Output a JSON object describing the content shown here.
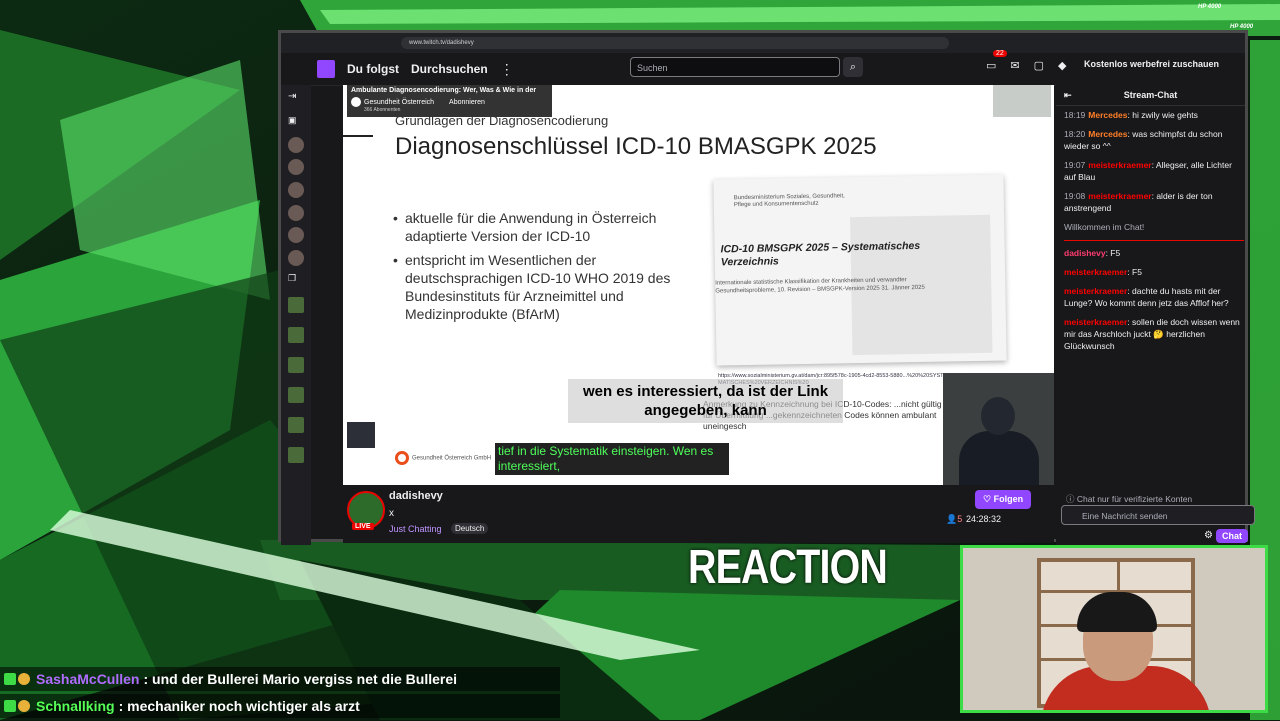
{
  "overlay": {
    "hp_top": "HP 4000",
    "hp_right": "HP 4000",
    "reaction_label": "REACTION",
    "chat_messages": [
      {
        "user": "SashaMcCullen",
        "text": ": und der Bullerei Mario vergiss net die Bullerei",
        "user_color": "#b06cff"
      },
      {
        "user": "Schnallking",
        "text": ": mechaniker noch wichtiger als arzt",
        "user_color": "#55ff55"
      }
    ]
  },
  "browser": {
    "url": "www.twitch.tv/dadishevy"
  },
  "twitch": {
    "nav": {
      "following": "Du folgst",
      "browse": "Durchsuchen",
      "more": "⋮"
    },
    "search": {
      "placeholder": "Suchen"
    },
    "notifications_count": "22",
    "adfree_label": "Kostenlos werbefrei zuschauen"
  },
  "video": {
    "yt_title": "Ambulante Diagnosencodierung: Wer, Was & Wie in der",
    "yt_channel": "Gesundheit Österreich",
    "yt_subs": "366 Abonnenten",
    "yt_subscribe": "Abonnieren",
    "slide_subtitle": "Grundlagen der Diagnosencodierung",
    "slide_title": "Diagnosenschlüssel ICD-10 BMASGPK 2025",
    "bullets": [
      "aktuelle für die Anwendung in Österreich adaptierte Version der ICD-10",
      "entspricht im Wesentlichen der deutschsprachigen ICD-10 WHO 2019 des Bundesinstituts für Arzneimittel und Medizinprodukte (BfArM)"
    ],
    "doc_department": "Bundesministerium Soziales, Gesundheit, Pflege und Konsumentenschutz",
    "doc_title": "ICD-10 BMSGPK 2025 – Systematisches Verzeichnis",
    "doc_subtitle": "Internationale statistische Klassifikation der Krankheiten und verwandter Gesundheitsprobleme, 10. Revision – BMSGPK-Version 2025 31. Jänner 2025",
    "link": "https://www.sozialministerium.gv.at/dam/jcr:895f578c-1905-4cd2-8553-5880...%20%20SYSTEMATISCHES%20VERZEICHNIS%20",
    "note": "Anmerkung zu Kennzeichnung bei ICD-10-Codes: ...nicht gültig für Übermittlung ...gekennzeichneten Codes können ambulant uneingesch",
    "caption_big": "wen es interessiert, da ist der Link angegeben, kann",
    "caption_green": "tief in die Systematik einsteigen. Wen es interessiert,",
    "gov_logo": "Gesundheit Österreich GmbH"
  },
  "channel": {
    "name": "dadishevy",
    "title": "x",
    "category": "Just Chatting",
    "language": "Deutsch",
    "live_label": "LIVE",
    "follow_label": "Folgen",
    "viewers": "5",
    "uptime": "24:28:32"
  },
  "chat": {
    "header": "Stream-Chat",
    "messages": [
      {
        "time": "18:19",
        "user": "Mercedes",
        "text": ": hi zwily wie gehts",
        "cls": "u-o"
      },
      {
        "time": "18:20",
        "user": "Mercedes",
        "text": ": was schimpfst du schon wieder so ^^",
        "cls": "u-o"
      },
      {
        "time": "19:07",
        "user": "meisterkraemer",
        "text": ": Allegser, alle Lichter auf Blau",
        "cls": "u-r"
      },
      {
        "time": "19:08",
        "user": "meisterkraemer",
        "text": ": alder is der ton anstrengend",
        "cls": "u-r"
      }
    ],
    "welcome": "Willkommen im Chat!",
    "messages2": [
      {
        "user": "dadishevy",
        "text": ": F5",
        "cls": "u-pink"
      },
      {
        "user": "meisterkraemer",
        "text": ": F5",
        "cls": "u-r"
      },
      {
        "user": "meisterkraemer",
        "text": ": dachte du hasts mit der Lunge? Wo kommt denn jetz das Afflof her?",
        "cls": "u-r"
      },
      {
        "user": "meisterkraemer",
        "text": ": sollen die doch wissen wenn mir das Arschloch juckt 🤔 herzlichen Glückwunsch",
        "cls": "u-r"
      }
    ],
    "verified_note": "Chat nur für verifizierte Konten",
    "input_placeholder": "Eine Nachricht senden",
    "chat_button": "Chat"
  },
  "colors": {
    "twitch_purple": "#9147ff",
    "neon_green": "#3ddc47",
    "live_red": "#eb0400"
  }
}
